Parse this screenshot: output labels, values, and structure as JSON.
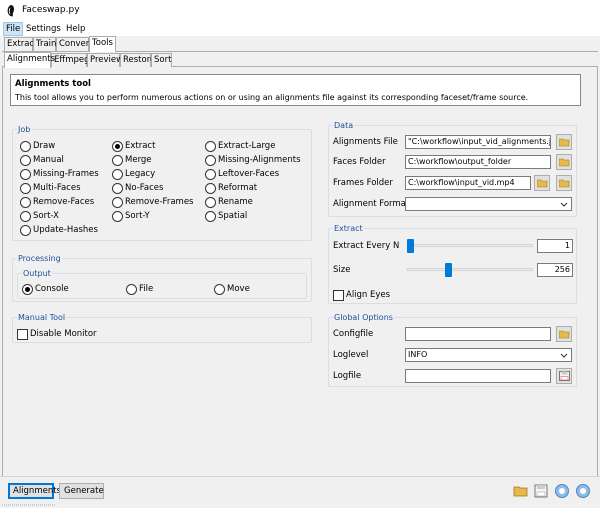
{
  "window": {
    "title": "Faceswap.py"
  },
  "menu": {
    "file": "File",
    "settings": "Settings",
    "help": "Help"
  },
  "main_tabs": [
    "Extract",
    "Train",
    "Convert",
    "Tools"
  ],
  "tool_tabs": [
    "Alignments",
    "Effmpeg",
    "Preview",
    "Restore",
    "Sort"
  ],
  "info": {
    "title": "Alignments tool",
    "description": "This tool allows you to perform numerous actions on or using an alignments file against its corresponding faceset/frame source."
  },
  "job": {
    "title": "Job",
    "options": [
      "Draw",
      "Extract",
      "Extract-Large",
      "Manual",
      "Merge",
      "Missing-Alignments",
      "Missing-Frames",
      "Legacy",
      "Leftover-Faces",
      "Multi-Faces",
      "No-Faces",
      "Reformat",
      "Remove-Faces",
      "Remove-Frames",
      "Rename",
      "Sort-X",
      "Sort-Y",
      "Spatial",
      "Update-Hashes"
    ],
    "selected": "Extract"
  },
  "processing": {
    "title": "Processing",
    "output_title": "Output",
    "options": [
      "Console",
      "File",
      "Move"
    ],
    "selected": "Console"
  },
  "manual_tool": {
    "title": "Manual Tool",
    "disable_monitor": "Disable Monitor",
    "disable_monitor_checked": false
  },
  "data": {
    "title": "Data",
    "alignments_file_label": "Alignments File",
    "alignments_file_value": "\"C:\\workflow\\input_vid_alignments.json",
    "faces_folder_label": "Faces Folder",
    "faces_folder_value": "C:\\workflow\\output_folder",
    "frames_folder_label": "Frames Folder",
    "frames_folder_value": "C:\\workflow\\input_vid.mp4",
    "alignment_format_label": "Alignment Format",
    "alignment_format_value": ""
  },
  "extract": {
    "title": "Extract",
    "extract_every_n_label": "Extract Every N",
    "extract_every_n_value": "1",
    "extract_every_n_fraction": 0.0,
    "size_label": "Size",
    "size_value": "256",
    "size_fraction": 0.3,
    "align_eyes_label": "Align Eyes",
    "align_eyes_checked": false
  },
  "global_options": {
    "title": "Global Options",
    "configfile_label": "Configfile",
    "configfile_value": "",
    "loglevel_label": "Loglevel",
    "loglevel_value": "INFO",
    "logfile_label": "Logfile",
    "logfile_value": ""
  },
  "bottom": {
    "alignments_button": "Alignments",
    "generate_button": "Generate"
  },
  "colors": {
    "accent": "#0078d7",
    "slider": "#007ad9",
    "group_title": "#1f4e9c"
  }
}
